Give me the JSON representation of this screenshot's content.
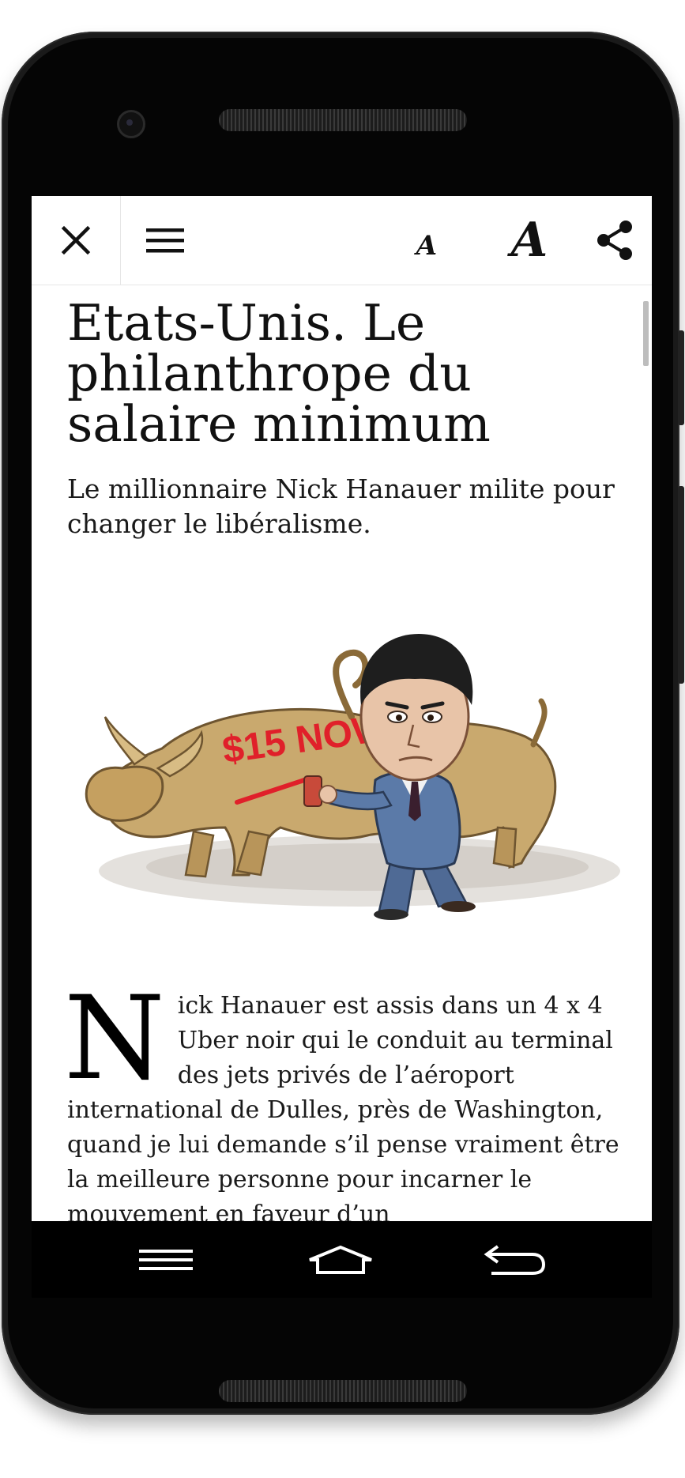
{
  "toolbar": {
    "font_small_label": "A",
    "font_large_label": "A"
  },
  "article": {
    "title": "Etats-Unis. Le philanthrope du salaire minimum",
    "subtitle": "Le millionnaire Nick Hanauer milite pour changer le libéralisme.",
    "illustration_graffiti": "$15 NOW",
    "dropcap": "N",
    "body": "ick Hanauer est assis dans un 4 x 4 Uber noir qui le conduit au terminal des jets privés de l’aéroport international de Dulles, près de Washington, quand je lui demande s’il pense vraiment être la meilleure personne pour incarner le mouvement en faveur d’un"
  },
  "colors": {
    "device": "#1a1a1a",
    "screen_bg": "#ffffff",
    "text": "#111111",
    "nav_bar": "#000000",
    "graffiti": "#e0202a"
  },
  "icons": {
    "close": "close-icon",
    "menu": "hamburger-menu-icon",
    "share": "share-icon",
    "recent": "recent-apps-icon",
    "home": "home-icon",
    "back": "back-icon"
  }
}
